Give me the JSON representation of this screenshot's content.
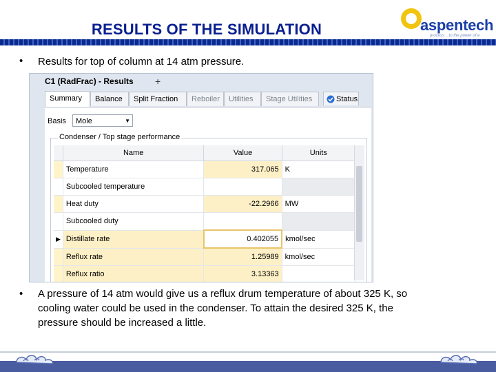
{
  "slide": {
    "title": "RESULTS OF THE SIMULATION",
    "logo_text": "aspentech",
    "logo_tagline": "process   ...to the power of e",
    "bullet_symbol": "•",
    "bullet1": "Results for top of column at 14 atm pressure.",
    "bullet2_lines": [
      "A pressure of 14 atm would give us a reflux drum temperature of about 325 K, so",
      "cooling water could be used in the condenser. To attain the desired 325 K, the",
      "pressure should be increased a little."
    ]
  },
  "window": {
    "title": "C1 (RadFrac) - Results",
    "tabs": [
      "Summary",
      "Balance",
      "Split Fraction",
      "Reboiler",
      "Utilities",
      "Stage Utilities",
      "Status"
    ],
    "active_tab": "Summary",
    "plus_label": "+",
    "basis_label": "Basis",
    "basis_value": "Mole",
    "group_label": "Condenser / Top stage performance",
    "columns": [
      "Name",
      "Value",
      "Units"
    ],
    "rows": [
      {
        "name": "Temperature",
        "value": "317.065",
        "units": "K"
      },
      {
        "name": "Subcooled temperature",
        "value": "",
        "units": ""
      },
      {
        "name": "Heat duty",
        "value": "-22.2966",
        "units": "MW"
      },
      {
        "name": "Subcooled duty",
        "value": "",
        "units": ""
      },
      {
        "name": "Distillate rate",
        "value": "0.402055",
        "units": "kmol/sec"
      },
      {
        "name": "Reflux rate",
        "value": "1.25989",
        "units": "kmol/sec"
      },
      {
        "name": "Reflux ratio",
        "value": "3.13363",
        "units": ""
      }
    ],
    "selected_row_marker": "▶"
  },
  "colors": {
    "title": "#0a1f8f",
    "band": "#0b2a8c",
    "value_highlight": "#fdf0c6",
    "status_icon": "#2b6fd1"
  },
  "icons": {
    "logo": "aspentech-logo-icon",
    "status": "status-check-icon",
    "dropdown": "chevron-down-icon"
  }
}
